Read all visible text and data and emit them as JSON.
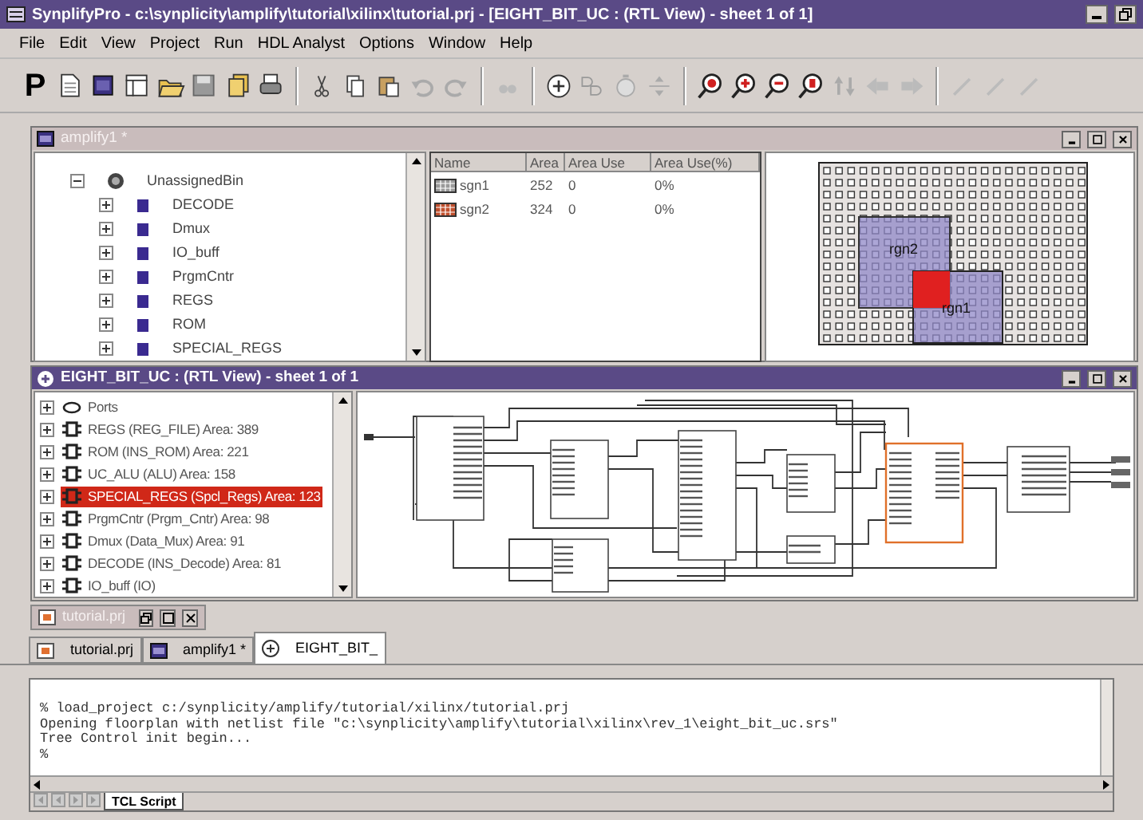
{
  "window": {
    "title": "SynplifyPro - c:\\synplicity\\amplify\\tutorial\\xilinx\\tutorial.prj - [EIGHT_BIT_UC : (RTL View) - sheet 1 of 1]"
  },
  "menu": [
    "File",
    "Edit",
    "View",
    "Project",
    "Run",
    "HDL Analyst",
    "Options",
    "Window",
    "Help"
  ],
  "toolbar": {
    "logo": "P"
  },
  "floorplan_window": {
    "title": "amplify1 *",
    "active": false,
    "tree": [
      {
        "label": "UnassignedBin",
        "expanded": true,
        "children": [
          {
            "label": "DECODE",
            "expanded": false
          },
          {
            "label": "Dmux",
            "expanded": false
          },
          {
            "label": "IO_buff",
            "expanded": false
          },
          {
            "label": "PrgmCntr",
            "expanded": false
          },
          {
            "label": "REGS",
            "expanded": false
          },
          {
            "label": "ROM",
            "expanded": false
          },
          {
            "label": "SPECIAL_REGS",
            "expanded": false
          }
        ]
      }
    ],
    "table": {
      "columns": [
        "Name",
        "Area",
        "Area Use",
        "Area Use(%)"
      ],
      "rows": [
        {
          "cells": [
            "sgn1",
            "252",
            "0",
            "0%"
          ],
          "color": "#9a9a9a"
        },
        {
          "cells": [
            "sgn2",
            "324",
            "0",
            "0%"
          ],
          "color": "#c0502e"
        }
      ]
    },
    "floorplan": {
      "regions": [
        {
          "label": "rgn2"
        },
        {
          "label": "rgn1"
        }
      ]
    }
  },
  "rtl_window": {
    "title": "EIGHT_BIT_UC : (RTL View) - sheet 1 of 1",
    "active": true,
    "tree": [
      {
        "label": "Ports",
        "kind": "port",
        "selected": false
      },
      {
        "label": "REGS (REG_FILE) Area: 389",
        "kind": "instance",
        "selected": false
      },
      {
        "label": "ROM (INS_ROM) Area: 221",
        "kind": "instance",
        "selected": false
      },
      {
        "label": "UC_ALU (ALU) Area: 158",
        "kind": "instance",
        "selected": false
      },
      {
        "label": "SPECIAL_REGS (Spcl_Regs) Area: 123",
        "kind": "instance",
        "selected": true
      },
      {
        "label": "PrgmCntr (Prgm_Cntr) Area: 98",
        "kind": "instance",
        "selected": false
      },
      {
        "label": "Dmux (Data_Mux) Area: 91",
        "kind": "instance",
        "selected": false
      },
      {
        "label": "DECODE (INS_Decode) Area: 81",
        "kind": "instance",
        "selected": false
      },
      {
        "label": "IO_buff (IO)",
        "kind": "instance",
        "selected": false
      }
    ]
  },
  "minimized_window": {
    "title": "tutorial.prj"
  },
  "document_tabs": [
    {
      "label": "tutorial.prj",
      "kind": "project",
      "selected": false
    },
    {
      "label": "amplify1 *",
      "kind": "floorplan",
      "selected": false
    },
    {
      "label": "EIGHT_BIT_",
      "kind": "rtl",
      "selected": true
    }
  ],
  "console": {
    "lines": [
      "% load_project c:/synplicity/amplify/tutorial/xilinx/tutorial.prj",
      "Opening floorplan with netlist file \"c:\\synplicity\\amplify\\tutorial\\xilinx\\rev_1\\eight_bit_uc.srs\"",
      "Tree Control init begin...",
      "%"
    ],
    "tabs": [
      {
        "label": "TCL Script",
        "selected": true
      }
    ]
  }
}
